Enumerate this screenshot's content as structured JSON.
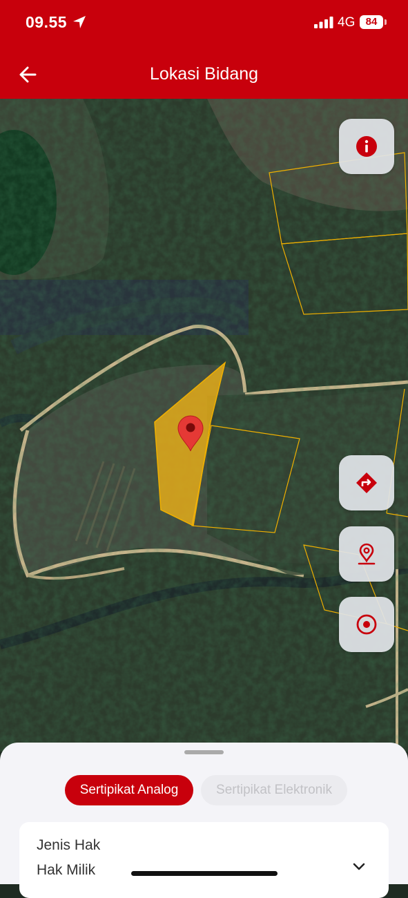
{
  "status_bar": {
    "time": "09.55",
    "network": "4G",
    "battery": "84"
  },
  "header": {
    "title": "Lokasi Bidang"
  },
  "map": {
    "parcel_fill_color": "#f2b316",
    "boundary_color": "#f0b000",
    "pin_color": "#e53935",
    "buttons": [
      "info",
      "directions",
      "location-pin",
      "my-location"
    ]
  },
  "sheet": {
    "tabs": [
      {
        "label": "Sertipikat Analog",
        "active": true
      },
      {
        "label": "Sertipikat Elektronik",
        "active": false
      }
    ],
    "field": {
      "label": "Jenis Hak",
      "value": "Hak Milik"
    }
  },
  "colors": {
    "brand": "#c8000c",
    "sheet_bg": "#f4f4f8"
  }
}
